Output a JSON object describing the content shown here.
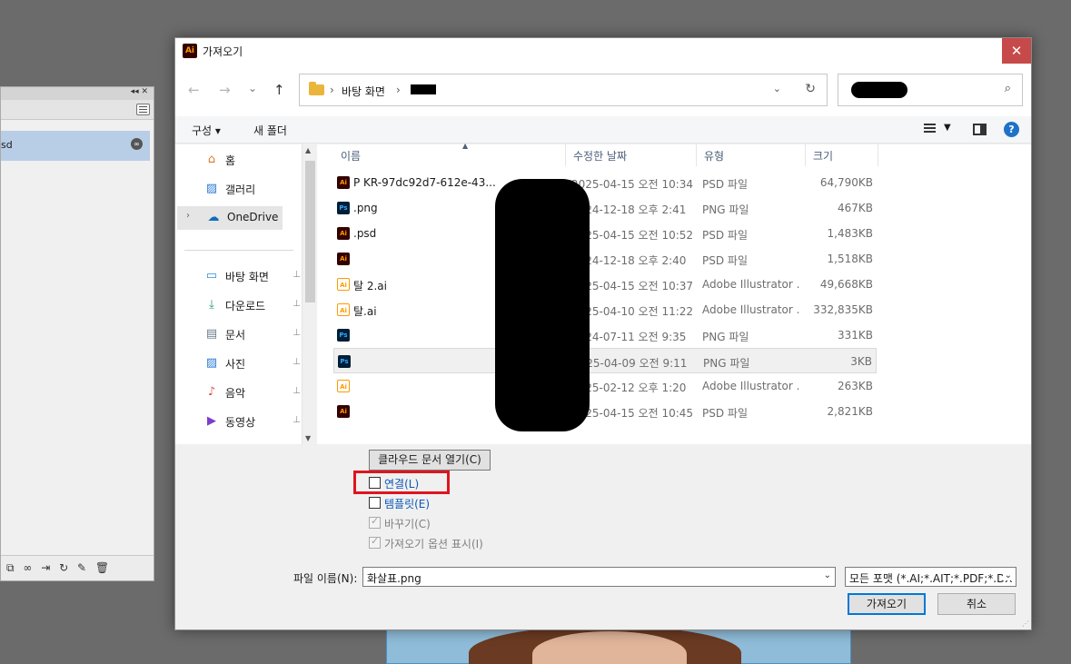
{
  "dialog": {
    "title": "가져오기",
    "app_icon": "Ai",
    "close": "✕"
  },
  "bg_panel": {
    "layer_name": "sd"
  },
  "nav": {
    "crumb_1": "바탕 화면",
    "sep": "›",
    "back": "←",
    "forward": "→",
    "recent": "⌄",
    "up": "↑"
  },
  "toolbar": {
    "organize": "구성 ▾",
    "new_folder": "새 폴더",
    "help": "?"
  },
  "sidebar": {
    "items": [
      {
        "label": "홈",
        "icon": "home-icon",
        "glyph": "⌂",
        "color": "#d67a2c",
        "pinned": false
      },
      {
        "label": "갤러리",
        "icon": "gallery-icon",
        "glyph": "▨",
        "color": "#2b7bd4",
        "pinned": false
      },
      {
        "label": "OneDrive",
        "icon": "onedrive-icon",
        "glyph": "☁",
        "color": "#0f6cbd",
        "pinned": false
      },
      {
        "label": "바탕 화면",
        "icon": "desktop-icon",
        "glyph": "▭",
        "color": "#2b8fd4",
        "pinned": true
      },
      {
        "label": "다운로드",
        "icon": "download-icon",
        "glyph": "⤓",
        "color": "#1f9e6b",
        "pinned": true
      },
      {
        "label": "문서",
        "icon": "documents-icon",
        "glyph": "▤",
        "color": "#6b7b8c",
        "pinned": true
      },
      {
        "label": "사진",
        "icon": "pictures-icon",
        "glyph": "▨",
        "color": "#2b7bd4",
        "pinned": true
      },
      {
        "label": "음악",
        "icon": "music-icon",
        "glyph": "♪",
        "color": "#d9534f",
        "pinned": true
      },
      {
        "label": "동영상",
        "icon": "videos-icon",
        "glyph": "▶",
        "color": "#7a3fc9",
        "pinned": true
      }
    ],
    "pin": "📌"
  },
  "columns": {
    "name": "이름",
    "modified": "수정한 날짜",
    "type": "유형",
    "size": "크기"
  },
  "files": [
    {
      "icon": "ai",
      "badge": "Ai",
      "name": "P                         KR-97dc92d7-612e-43...",
      "date": "2025-04-15 오전 10:34",
      "type": "PSD 파일",
      "size": "64,790KB"
    },
    {
      "icon": "ps",
      "badge": "Ps",
      "name": "                          .png",
      "date": "2024-12-18 오후 2:41",
      "type": "PNG 파일",
      "size": "467KB"
    },
    {
      "icon": "ai",
      "badge": "Ai",
      "name": "                          .psd",
      "date": "2025-04-15 오전 10:52",
      "type": "PSD 파일",
      "size": "1,483KB"
    },
    {
      "icon": "ai",
      "badge": "Ai",
      "name": "",
      "date": "2024-12-18 오후 2:40",
      "type": "PSD 파일",
      "size": "1,518KB"
    },
    {
      "icon": "aidoc",
      "badge": "Ai",
      "name": "                        탈 2.ai",
      "date": "2025-04-15 오전 10:37",
      "type": "Adobe Illustrator ...",
      "size": "49,668KB"
    },
    {
      "icon": "aidoc",
      "badge": "Ai",
      "name": "                        탈.ai",
      "date": "2025-04-10 오전 11:22",
      "type": "Adobe Illustrator ...",
      "size": "332,835KB"
    },
    {
      "icon": "ps",
      "badge": "Ps",
      "name": "",
      "date": "2024-07-11 오전 9:35",
      "type": "PNG 파일",
      "size": "331KB"
    },
    {
      "icon": "ps",
      "badge": "Ps",
      "name": "",
      "date": "2025-04-09 오전 9:11",
      "type": "PNG 파일",
      "size": "3KB",
      "selected": true
    },
    {
      "icon": "aidoc",
      "badge": "Ai",
      "name": "",
      "date": "2025-02-12 오후 1:20",
      "type": "Adobe Illustrator ...",
      "size": "263KB"
    },
    {
      "icon": "ai",
      "badge": "Ai",
      "name": "",
      "date": "2025-04-15 오전 10:45",
      "type": "PSD 파일",
      "size": "2,821KB"
    }
  ],
  "options": {
    "cloud_button": "클라우드 문서 열기(C)",
    "link": "연결(L)",
    "template": "템플릿(E)",
    "replace": "바꾸기(C)",
    "show_import_options": "가져오기 옵션 표시(I)"
  },
  "footer": {
    "filename_label": "파일 이름(N):",
    "filename_value": "화살표.png",
    "format_value": "모든 포맷 (*.AI;*.AIT;*.PDF;*.DX",
    "import_button": "가져오기",
    "cancel_button": "취소"
  },
  "colors": {
    "highlight": "#e0141e",
    "accent": "#0078d7",
    "link_blue": "#0b57b6"
  }
}
